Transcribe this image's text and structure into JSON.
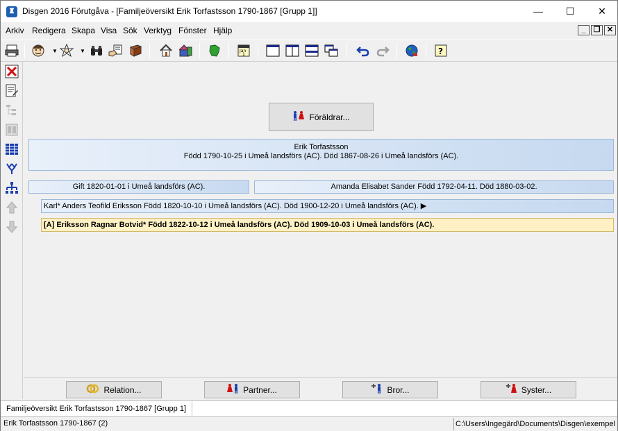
{
  "window": {
    "title": "Disgen 2016 Förutgåva - [Familjeöversikt Erik Torfastsson 1790-1867 [Grupp 1]]",
    "minimize": "—",
    "maximize": "☐",
    "close": "✕"
  },
  "menu": {
    "items": [
      "Arkiv",
      "Redigera",
      "Skapa",
      "Visa",
      "Sök",
      "Verktyg",
      "Fönster",
      "Hjälp"
    ]
  },
  "mdi": {
    "minimize": "_",
    "restore": "❐",
    "close": "✕"
  },
  "main": {
    "parents_label": "Föräldrar...",
    "person_name": "Erik Torfastsson",
    "person_details": "Född 1790-10-25 i Umeå landsförs (AC). Död 1867-08-26 i Umeå landsförs (AC).",
    "marriage": "Gift 1820-01-01 i Umeå landsförs (AC).",
    "spouse": "Amanda Elisabet Sander Född 1792-04-11. Död 1880-03-02.",
    "children": [
      "Karl* Anders Teofild Eriksson Född 1820-10-10 i Umeå landsförs (AC). Död 1900-12-20 i Umeå landsförs (AC).  ▶",
      "[A] Eriksson Ragnar Botvid* Född 1822-10-12 i Umeå landsförs (AC). Död 1909-10-03 i Umeå landsförs (AC)."
    ]
  },
  "bottom_buttons": {
    "relation": "Relation...",
    "partner": "Partner...",
    "brother": "Bror...",
    "sister": "Syster..."
  },
  "tab": {
    "label": "Familjeöversikt Erik Torfastsson 1790-1867 [Grupp 1]"
  },
  "status": {
    "left": "Erik Torfastsson 1790-1867 (2)",
    "right": "C:\\Users\\Ingegärd\\Documents\\Disgen\\exempel"
  },
  "colors": {
    "person_box": "#c6d9f0",
    "selected_child": "#fff1c4",
    "male": "#1a3fb0",
    "female": "#d01010"
  }
}
